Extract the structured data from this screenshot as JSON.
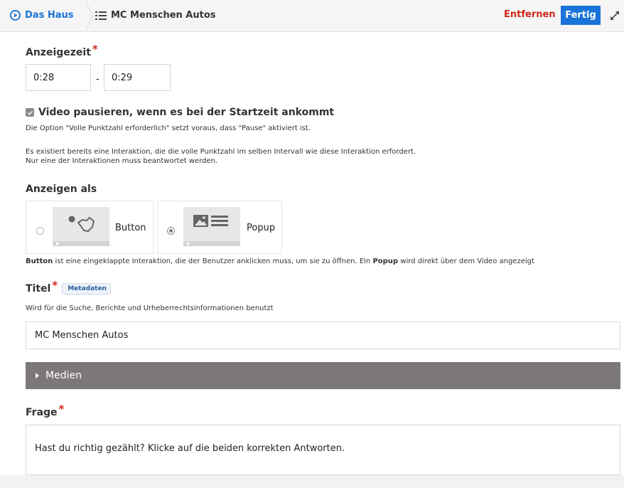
{
  "topbar": {
    "home_label": "Das Haus",
    "current_label": "MC Menschen Autos",
    "remove_label": "Entfernen",
    "done_label": "Fertig",
    "accent_color": "#1a73d9",
    "danger_color": "#d0261a"
  },
  "display_time": {
    "label": "Anzeigezeit",
    "required_mark": "*",
    "start": "0:28",
    "separator": "-",
    "end": "0:29"
  },
  "pause": {
    "checked": true,
    "label": "Video pausieren, wenn es bei der Startzeit ankommt",
    "note": "Die Option \"Volle Punktzahl erforderlich\" setzt voraus, dass \"Pause\" aktiviert ist.",
    "warning_line1": "Es existiert bereits eine Interaktion, die die volle Punktzahl im selben Intervall wie diese Interaktion erfordert.",
    "warning_line2": "Nur eine der Interaktionen muss beantwortet werden."
  },
  "display_as": {
    "label": "Anzeigen als",
    "options": [
      {
        "label": "Button",
        "selected": false,
        "icon": "button-interaction-icon"
      },
      {
        "label": "Popup",
        "selected": true,
        "icon": "popup-interaction-icon"
      }
    ],
    "explain_button": "Button",
    "explain_mid": " ist eine eingeklappte Interaktion, die der Benutzer anklicken muss, um sie zu öffnen. Ein ",
    "explain_popup": "Popup",
    "explain_end": " wird direkt über dem Video angezeigt"
  },
  "title_field": {
    "label": "Titel",
    "required_mark": "*",
    "tag": "Metadaten",
    "description": "Wird für die Suche, Berichte und Urheberrechtsinformationen benutzt",
    "value": "MC Menschen Autos"
  },
  "media": {
    "label": "Medien"
  },
  "question": {
    "label": "Frage",
    "required_mark": "*",
    "value": "Hast du richtig gezählt? Klicke auf die beiden korrekten Antworten."
  }
}
